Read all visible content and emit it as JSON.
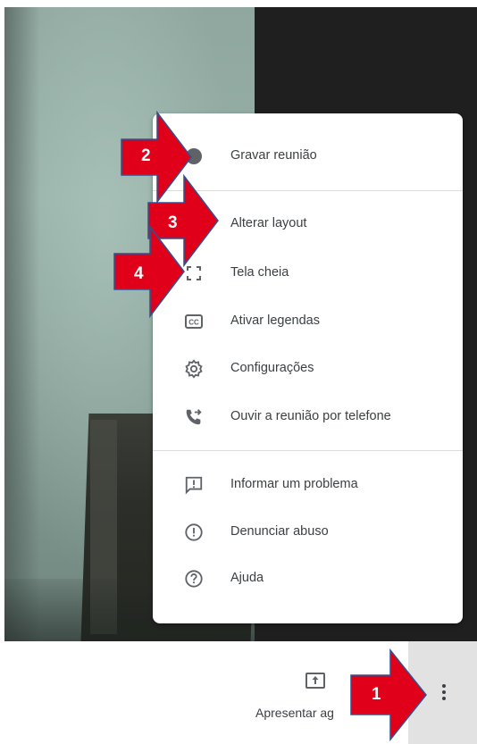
{
  "menu": {
    "items": [
      {
        "label": "Gravar reunião",
        "icon": "record-dot-icon"
      },
      {
        "label": "Alterar layout",
        "icon": "layout-icon"
      },
      {
        "label": "Tela cheia",
        "icon": "fullscreen-icon"
      },
      {
        "label": "Ativar legendas",
        "icon": "closed-captions-icon"
      },
      {
        "label": "Configurações",
        "icon": "gear-icon"
      },
      {
        "label": "Ouvir a reunião por telefone",
        "icon": "phone-forward-icon"
      },
      {
        "label": "Informar um problema",
        "icon": "feedback-icon"
      },
      {
        "label": "Denunciar abuso",
        "icon": "report-icon"
      },
      {
        "label": "Ajuda",
        "icon": "help-icon"
      }
    ]
  },
  "bottom_bar": {
    "present_label": "Apresentar ag"
  },
  "callouts": {
    "one": "1",
    "two": "2",
    "three": "3",
    "four": "4"
  },
  "colors": {
    "callout_red": "#e1001a",
    "callout_border": "#2f528f",
    "icon": "#5f6368",
    "text": "#3c4043"
  }
}
